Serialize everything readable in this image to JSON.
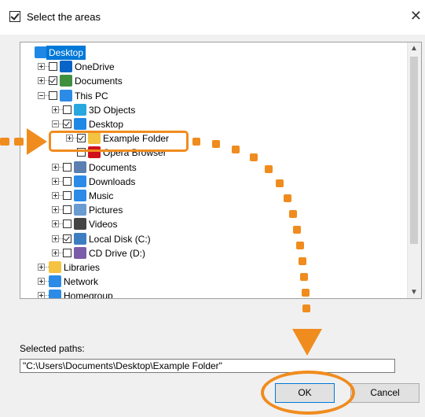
{
  "window": {
    "title": "Select the areas"
  },
  "tree": {
    "rows": [
      {
        "label": "Desktop",
        "indent": 0,
        "icon": "desktop-icon",
        "icon_color": "#1e88e5",
        "checkbox": "none",
        "expander": "none",
        "selected": true
      },
      {
        "label": "OneDrive",
        "indent": 1,
        "icon": "onedrive-icon",
        "icon_color": "#0a64c8",
        "checkbox": "unchecked",
        "expander": "plus"
      },
      {
        "label": "Documents",
        "indent": 1,
        "icon": "user-icon",
        "icon_color": "#3f8f3f",
        "checkbox": "checked",
        "expander": "plus"
      },
      {
        "label": "This PC",
        "indent": 1,
        "icon": "monitor-icon",
        "icon_color": "#2b8be6",
        "checkbox": "unchecked",
        "expander": "minus"
      },
      {
        "label": "3D Objects",
        "indent": 2,
        "icon": "cube-icon",
        "icon_color": "#29a8e0",
        "checkbox": "unchecked",
        "expander": "plus"
      },
      {
        "label": "Desktop",
        "indent": 2,
        "icon": "desktop-icon",
        "icon_color": "#1e88e5",
        "checkbox": "checked",
        "expander": "minus"
      },
      {
        "label": "Example Folder",
        "indent": 3,
        "icon": "folder-icon",
        "icon_color": "#f5c342",
        "checkbox": "checked",
        "expander": "plus"
      },
      {
        "label": "Opera Browser",
        "indent": 3,
        "icon": "opera-icon",
        "icon_color": "#d0111b",
        "checkbox": "unchecked",
        "expander": "none"
      },
      {
        "label": "Documents",
        "indent": 2,
        "icon": "document-icon",
        "icon_color": "#5b7fb0",
        "checkbox": "unchecked",
        "expander": "plus"
      },
      {
        "label": "Downloads",
        "indent": 2,
        "icon": "download-icon",
        "icon_color": "#2b8be6",
        "checkbox": "unchecked",
        "expander": "plus"
      },
      {
        "label": "Music",
        "indent": 2,
        "icon": "music-icon",
        "icon_color": "#2b8be6",
        "checkbox": "unchecked",
        "expander": "plus"
      },
      {
        "label": "Pictures",
        "indent": 2,
        "icon": "pictures-icon",
        "icon_color": "#6a9bd1",
        "checkbox": "unchecked",
        "expander": "plus"
      },
      {
        "label": "Videos",
        "indent": 2,
        "icon": "video-icon",
        "icon_color": "#444444",
        "checkbox": "unchecked",
        "expander": "plus"
      },
      {
        "label": "Local Disk (C:)",
        "indent": 2,
        "icon": "disk-icon",
        "icon_color": "#3d7ec2",
        "checkbox": "checked",
        "expander": "plus"
      },
      {
        "label": "CD Drive (D:)",
        "indent": 2,
        "icon": "cd-icon",
        "icon_color": "#7a5ca8",
        "checkbox": "unchecked",
        "expander": "plus"
      },
      {
        "label": "Libraries",
        "indent": 1,
        "icon": "libraries-icon",
        "icon_color": "#f5c342",
        "checkbox": "none",
        "expander": "plus"
      },
      {
        "label": "Network",
        "indent": 1,
        "icon": "network-icon",
        "icon_color": "#2b8be6",
        "checkbox": "none",
        "expander": "plus"
      },
      {
        "label": "Homegroup",
        "indent": 1,
        "icon": "homegroup-icon",
        "icon_color": "#2b8be6",
        "checkbox": "none",
        "expander": "plus"
      }
    ]
  },
  "footer": {
    "selected_label": "Selected paths:",
    "selected_value": "\"C:\\Users\\Documents\\Desktop\\Example Folder\"",
    "ok_label": "OK",
    "cancel_label": "Cancel"
  },
  "annotation": {
    "accent_color": "#f08c1e"
  }
}
